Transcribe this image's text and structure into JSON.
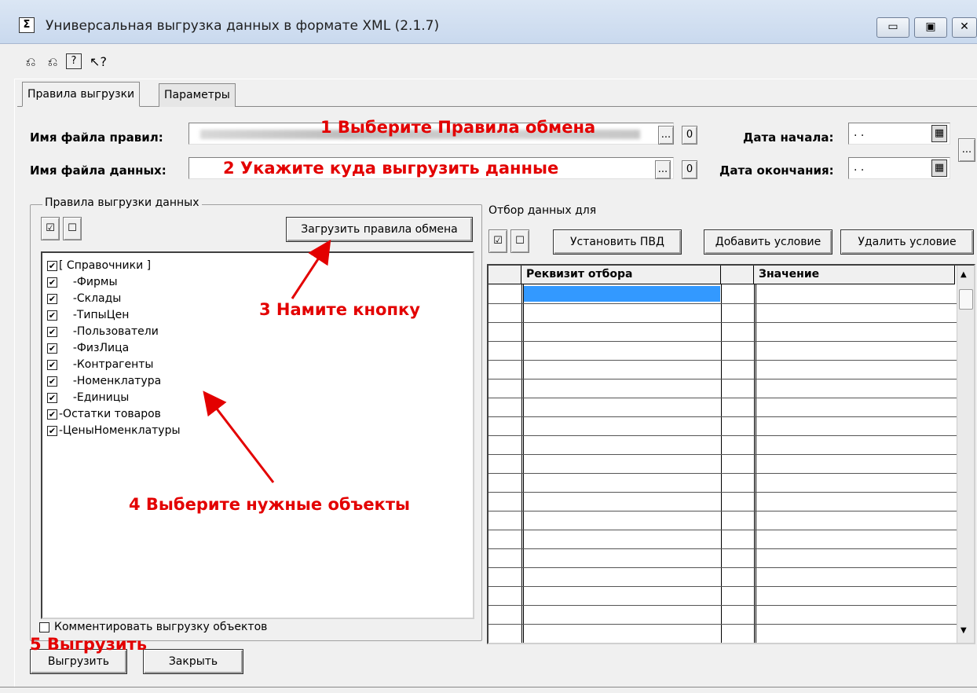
{
  "window": {
    "title": "Универсальная выгрузка данных в формате XML (2.1.7)",
    "icon_glyph": "Σ",
    "controls": {
      "minimize": "▭",
      "maximize": "▣",
      "close": "✕"
    }
  },
  "toolbar": {
    "icons": [
      "open-rules-icon",
      "save-rules-icon",
      "help-icon",
      "context-help-icon"
    ],
    "glyphs": [
      "⎌",
      "⎌",
      "?",
      "↖?"
    ]
  },
  "tabs": {
    "rules": "Правила выгрузки",
    "params": "Параметры"
  },
  "fields": {
    "rules_file_label": "Имя файла правил:",
    "data_file_label": "Имя файла данных:",
    "start_date_label": "Дата начала:",
    "end_date_label": "Дата окончания:",
    "start_date_value": " . .",
    "end_date_value": " . .",
    "browse": "...",
    "open": "0",
    "period": "..."
  },
  "rules_panel": {
    "title": "Правила выгрузки данных",
    "load_button": "Загрузить правила обмена",
    "check_all": "☑",
    "uncheck_all": "☐",
    "items": [
      {
        "label": "[ Справочники ]",
        "checked": true
      },
      {
        "label": "-Фирмы",
        "checked": true
      },
      {
        "label": "-Склады",
        "checked": true
      },
      {
        "label": "-ТипыЦен",
        "checked": true
      },
      {
        "label": "-Пользователи",
        "checked": true
      },
      {
        "label": "-ФизЛица",
        "checked": true
      },
      {
        "label": "-Контрагенты",
        "checked": true
      },
      {
        "label": "-Номенклатура",
        "checked": true
      },
      {
        "label": "-Единицы",
        "checked": true
      },
      {
        "label": "-Остатки товаров",
        "checked": true
      },
      {
        "label": "-ЦеныНоменклатуры",
        "checked": true
      }
    ],
    "comment_checkbox": "Комментировать выгрузку объектов"
  },
  "filter_panel": {
    "title": "Отбор данных для",
    "set_button": "Установить ПВД",
    "add_button": "Добавить условие",
    "delete_button": "Удалить условие",
    "col_attr": "Реквизит отбора",
    "col_value": "Значение"
  },
  "buttons": {
    "export": "Выгрузить",
    "close": "Закрыть"
  },
  "annotations": {
    "a1": "1 Выберите Правила обмена",
    "a2": "2 Укажите куда выгрузить данные",
    "a3": "3 Намите кнопку",
    "a4": "4 Выберите нужные объекты",
    "a5": "5 Выгрузить"
  },
  "colors": {
    "annotation": "#e30000",
    "selection": "#3399ff"
  }
}
